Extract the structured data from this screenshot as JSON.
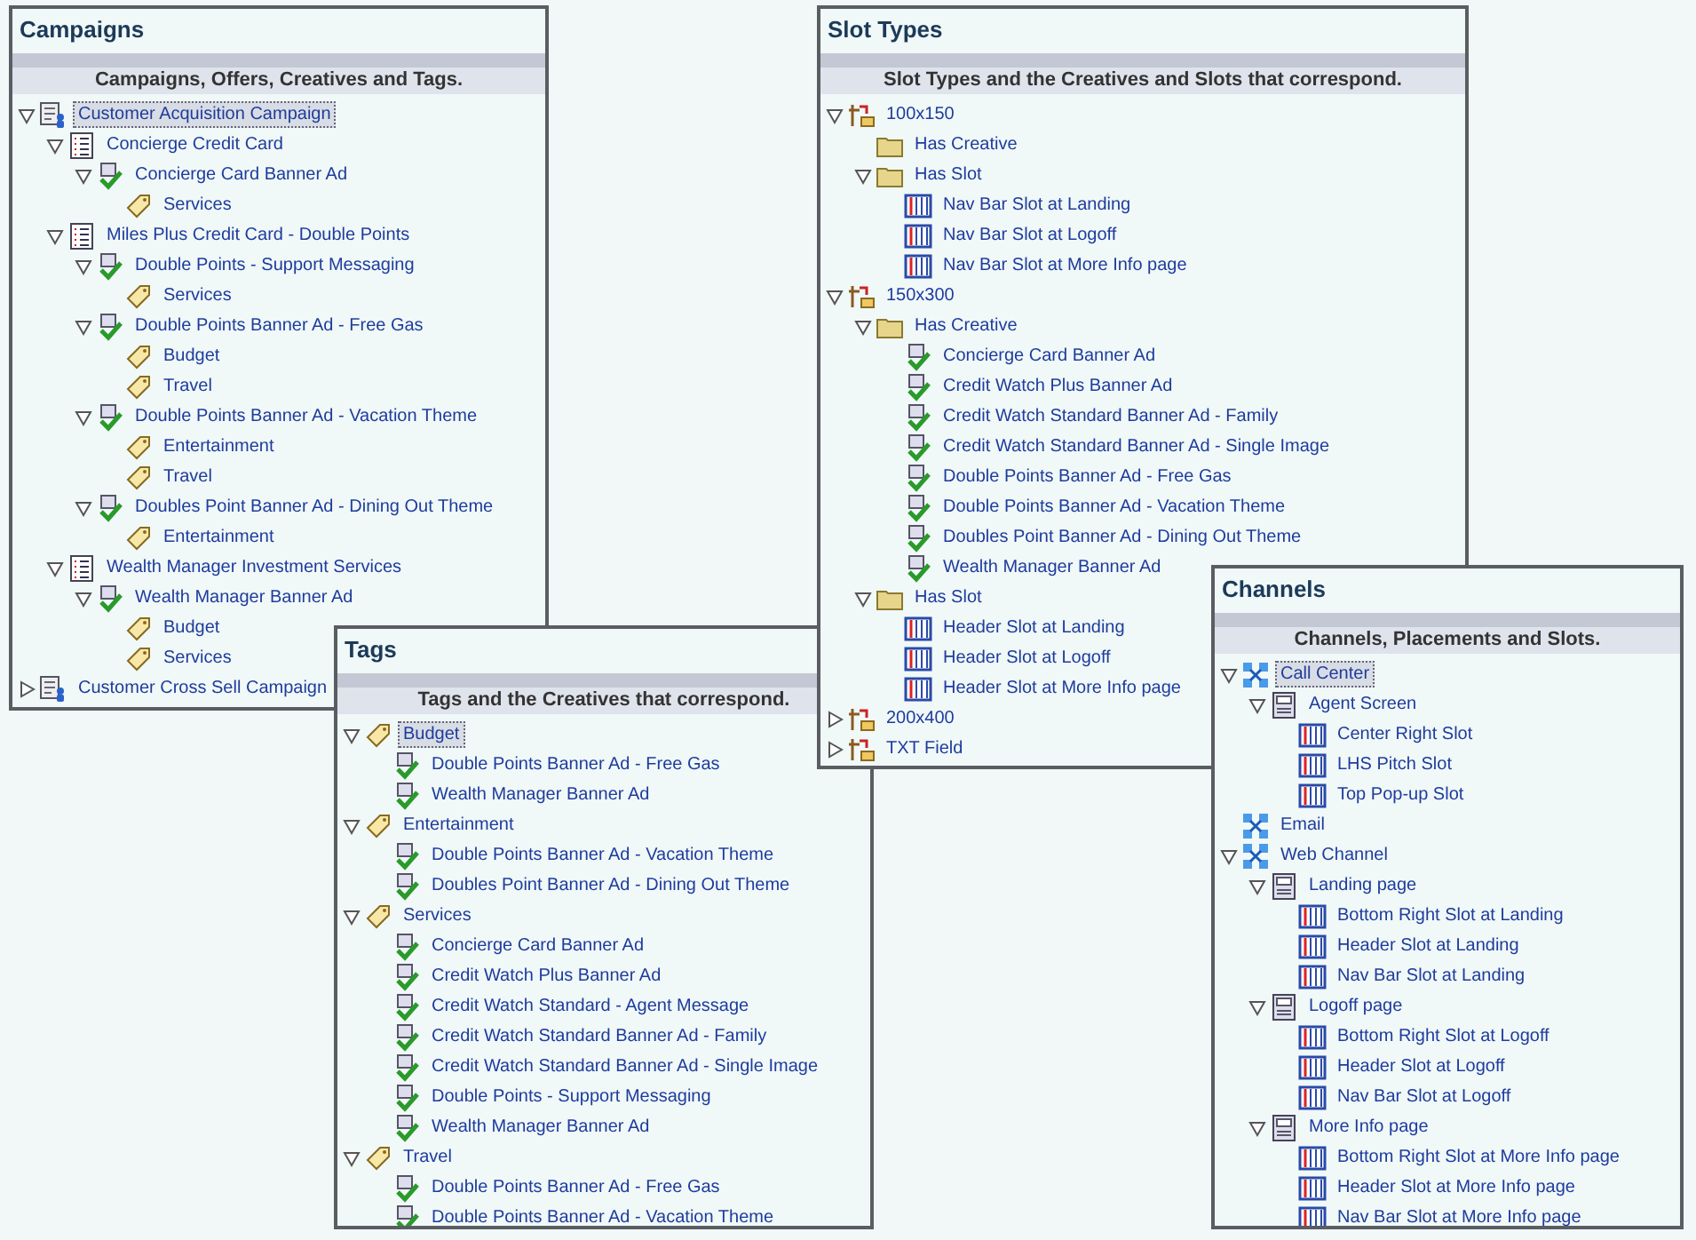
{
  "panels": [
    {
      "title": "Campaigns",
      "subtitle": "Campaigns, Offers, Creatives and Tags.",
      "tree": [
        {
          "label": "Customer Acquisition Campaign",
          "kind": "campaign",
          "selected": true,
          "expanded": true,
          "children": [
            {
              "label": "Concierge Credit Card",
              "kind": "offer",
              "selected": false,
              "expanded": true,
              "children": [
                {
                  "label": "Concierge Card Banner Ad",
                  "kind": "creative",
                  "selected": false,
                  "expanded": true,
                  "children": [
                    {
                      "label": "Services",
                      "kind": "tag",
                      "selected": false
                    }
                  ]
                }
              ]
            },
            {
              "label": "Miles Plus Credit Card - Double Points",
              "kind": "offer",
              "selected": false,
              "expanded": true,
              "children": [
                {
                  "label": "Double Points - Support Messaging",
                  "kind": "creative",
                  "selected": false,
                  "expanded": true,
                  "children": [
                    {
                      "label": "Services",
                      "kind": "tag",
                      "selected": false
                    }
                  ]
                },
                {
                  "label": "Double Points Banner Ad - Free Gas",
                  "kind": "creative",
                  "selected": false,
                  "expanded": true,
                  "children": [
                    {
                      "label": "Budget",
                      "kind": "tag",
                      "selected": false
                    },
                    {
                      "label": "Travel",
                      "kind": "tag",
                      "selected": false
                    }
                  ]
                },
                {
                  "label": "Double Points Banner Ad - Vacation Theme",
                  "kind": "creative",
                  "selected": false,
                  "expanded": true,
                  "children": [
                    {
                      "label": "Entertainment",
                      "kind": "tag",
                      "selected": false
                    },
                    {
                      "label": "Travel",
                      "kind": "tag",
                      "selected": false
                    }
                  ]
                },
                {
                  "label": "Doubles Point  Banner Ad - Dining Out Theme",
                  "kind": "creative",
                  "selected": false,
                  "expanded": true,
                  "children": [
                    {
                      "label": "Entertainment",
                      "kind": "tag",
                      "selected": false
                    }
                  ]
                }
              ]
            },
            {
              "label": "Wealth Manager Investment Services",
              "kind": "offer",
              "selected": false,
              "expanded": true,
              "children": [
                {
                  "label": "Wealth Manager Banner Ad",
                  "kind": "creative",
                  "selected": false,
                  "expanded": true,
                  "children": [
                    {
                      "label": "Budget",
                      "kind": "tag",
                      "selected": false
                    },
                    {
                      "label": "Services",
                      "kind": "tag",
                      "selected": false
                    }
                  ]
                }
              ]
            }
          ]
        },
        {
          "label": "Customer Cross Sell Campaign",
          "kind": "campaign",
          "selected": false,
          "expanded": false
        }
      ]
    },
    {
      "title": "Slot Types",
      "subtitle": "Slot Types and the Creatives and Slots that correspond.",
      "tree": [
        {
          "label": "100x150",
          "kind": "slottype",
          "selected": false,
          "expanded": true,
          "children": [
            {
              "label": "Has Creative",
              "kind": "folder",
              "selected": false
            },
            {
              "label": "Has Slot",
              "kind": "folder",
              "selected": false,
              "expanded": true,
              "children": [
                {
                  "label": "Nav Bar Slot at Landing",
                  "kind": "slot",
                  "selected": false
                },
                {
                  "label": "Nav Bar Slot at Logoff",
                  "kind": "slot",
                  "selected": false
                },
                {
                  "label": "Nav Bar Slot at More Info page",
                  "kind": "slot",
                  "selected": false
                }
              ]
            }
          ]
        },
        {
          "label": "150x300",
          "kind": "slottype",
          "selected": false,
          "expanded": true,
          "children": [
            {
              "label": "Has Creative",
              "kind": "folder",
              "selected": false,
              "expanded": true,
              "children": [
                {
                  "label": "Concierge Card Banner Ad",
                  "kind": "creative",
                  "selected": false
                },
                {
                  "label": "Credit Watch Plus Banner Ad",
                  "kind": "creative",
                  "selected": false
                },
                {
                  "label": "Credit Watch Standard Banner Ad - Family",
                  "kind": "creative",
                  "selected": false
                },
                {
                  "label": "Credit Watch Standard Banner Ad - Single Image",
                  "kind": "creative",
                  "selected": false
                },
                {
                  "label": "Double Points Banner Ad - Free Gas",
                  "kind": "creative",
                  "selected": false
                },
                {
                  "label": "Double Points Banner Ad - Vacation Theme",
                  "kind": "creative",
                  "selected": false
                },
                {
                  "label": "Doubles Point  Banner Ad - Dining Out Theme",
                  "kind": "creative",
                  "selected": false
                },
                {
                  "label": "Wealth Manager Banner Ad",
                  "kind": "creative",
                  "selected": false
                }
              ]
            },
            {
              "label": "Has Slot",
              "kind": "folder",
              "selected": false,
              "expanded": true,
              "children": [
                {
                  "label": "Header Slot at Landing",
                  "kind": "slot",
                  "selected": false
                },
                {
                  "label": "Header Slot at Logoff",
                  "kind": "slot",
                  "selected": false
                },
                {
                  "label": "Header Slot at More Info page",
                  "kind": "slot",
                  "selected": false
                }
              ]
            }
          ]
        },
        {
          "label": "200x400",
          "kind": "slottype",
          "selected": false,
          "expanded": false
        },
        {
          "label": "TXT Field",
          "kind": "slottype",
          "selected": false,
          "expanded": false
        }
      ]
    },
    {
      "title": "Tags",
      "subtitle": "Tags and the Creatives that correspond.",
      "tree": [
        {
          "label": "Budget",
          "kind": "tag",
          "selected": true,
          "expanded": true,
          "children": [
            {
              "label": "Double Points Banner Ad - Free Gas",
              "kind": "creative",
              "selected": false
            },
            {
              "label": "Wealth Manager Banner Ad",
              "kind": "creative",
              "selected": false
            }
          ]
        },
        {
          "label": "Entertainment",
          "kind": "tag",
          "selected": false,
          "expanded": true,
          "children": [
            {
              "label": "Double Points Banner Ad - Vacation Theme",
              "kind": "creative",
              "selected": false
            },
            {
              "label": "Doubles Point  Banner Ad - Dining Out Theme",
              "kind": "creative",
              "selected": false
            }
          ]
        },
        {
          "label": "Services",
          "kind": "tag",
          "selected": false,
          "expanded": true,
          "children": [
            {
              "label": "Concierge Card Banner Ad",
              "kind": "creative",
              "selected": false
            },
            {
              "label": "Credit Watch Plus Banner Ad",
              "kind": "creative",
              "selected": false
            },
            {
              "label": "Credit Watch Standard - Agent Message",
              "kind": "creative",
              "selected": false
            },
            {
              "label": "Credit Watch Standard Banner Ad - Family",
              "kind": "creative",
              "selected": false
            },
            {
              "label": "Credit Watch Standard Banner Ad - Single Image",
              "kind": "creative",
              "selected": false
            },
            {
              "label": "Double Points - Support Messaging",
              "kind": "creative",
              "selected": false
            },
            {
              "label": "Wealth Manager Banner Ad",
              "kind": "creative",
              "selected": false
            }
          ]
        },
        {
          "label": "Travel",
          "kind": "tag",
          "selected": false,
          "expanded": true,
          "children": [
            {
              "label": "Double Points Banner Ad - Free Gas",
              "kind": "creative",
              "selected": false
            },
            {
              "label": "Double Points Banner Ad - Vacation Theme",
              "kind": "creative",
              "selected": false
            }
          ]
        }
      ]
    },
    {
      "title": "Channels",
      "subtitle": "Channels, Placements and Slots.",
      "tree": [
        {
          "label": "Call Center",
          "kind": "channel",
          "selected": true,
          "expanded": true,
          "children": [
            {
              "label": "Agent Screen",
              "kind": "placement",
              "selected": false,
              "expanded": true,
              "children": [
                {
                  "label": "Center Right Slot",
                  "kind": "slot",
                  "selected": false
                },
                {
                  "label": "LHS Pitch Slot",
                  "kind": "slot",
                  "selected": false
                },
                {
                  "label": "Top Pop-up Slot",
                  "kind": "slot",
                  "selected": false
                }
              ]
            }
          ]
        },
        {
          "label": "Email",
          "kind": "channel",
          "selected": false
        },
        {
          "label": "Web Channel",
          "kind": "channel",
          "selected": false,
          "expanded": true,
          "children": [
            {
              "label": "Landing page",
              "kind": "placement",
              "selected": false,
              "expanded": true,
              "children": [
                {
                  "label": "Bottom Right Slot at Landing",
                  "kind": "slot",
                  "selected": false
                },
                {
                  "label": "Header Slot at Landing",
                  "kind": "slot",
                  "selected": false
                },
                {
                  "label": "Nav Bar Slot at Landing",
                  "kind": "slot",
                  "selected": false
                }
              ]
            },
            {
              "label": "Logoff page",
              "kind": "placement",
              "selected": false,
              "expanded": true,
              "children": [
                {
                  "label": "Bottom Right Slot at Logoff",
                  "kind": "slot",
                  "selected": false
                },
                {
                  "label": "Header Slot at Logoff",
                  "kind": "slot",
                  "selected": false
                },
                {
                  "label": "Nav Bar Slot at Logoff",
                  "kind": "slot",
                  "selected": false
                }
              ]
            },
            {
              "label": "More Info page",
              "kind": "placement",
              "selected": false,
              "expanded": true,
              "children": [
                {
                  "label": "Bottom Right Slot at More Info page",
                  "kind": "slot",
                  "selected": false
                },
                {
                  "label": "Header Slot at More Info page",
                  "kind": "slot",
                  "selected": false
                },
                {
                  "label": "Nav Bar Slot at More Info page",
                  "kind": "slot",
                  "selected": false
                }
              ]
            }
          ]
        }
      ]
    }
  ]
}
